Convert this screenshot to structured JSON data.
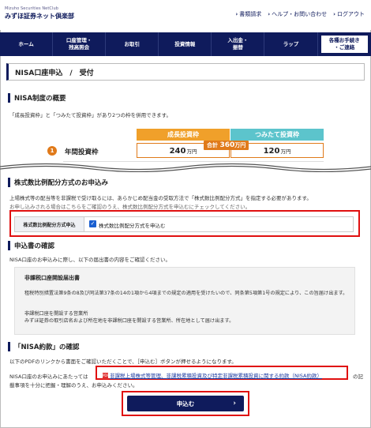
{
  "header": {
    "logo_en": "Mizuho Securities NetClub",
    "logo_jp": "みずほ証券ネット倶楽部",
    "links": [
      "書類請求",
      "ヘルプ・お問い合わせ",
      "ログアウト"
    ]
  },
  "nav": [
    "ホーム",
    "口座管理・\n残高照会",
    "お取引",
    "投資情報",
    "入出金・\n振替",
    "ラップ",
    "各種お手続き\n・ご連絡"
  ],
  "page_title": "NISA口座申込　/　受付",
  "overview": {
    "heading": "NISA制度の概要",
    "text": "「成長投資枠」と「つみたて投資枠」があり2つの枠を併用できます。",
    "growth_label": "成長投資枠",
    "tsumi_label": "つみたて投資枠",
    "badge": "1",
    "annual_label": "年間投資枠",
    "growth_value": "240",
    "tsumi_value": "120",
    "unit": "万円",
    "total_prefix": "合計",
    "total_value": "360",
    "total_unit": "万円"
  },
  "ratio": {
    "heading": "株式数比例配分方式のお申込み",
    "text1": "上場株式等の配当等を非課税で受け取るには、あらかじめ配当金の受取方法で「株式数比例配分方式」を指定する必要があります。",
    "text2": "お申し込みされる場合はこちらをご確認のうえ、株式数比例配分方式を申込むにチェックしてください。",
    "label": "株式数比例配分方式申込",
    "checkbox_text": "株式数比例配分方式を申込む"
  },
  "confirm": {
    "heading": "申込書の確認",
    "text": "NISA口座のお申込みに際し、以下の届出書の内容をご確認ください。",
    "doc_title": "非課税口座開設届出書",
    "doc_p1": "租税特別措置法第9条の8及び同法第37条の14の1項から4項までの規定の適用を受けたいので、同条第5項第1号の規定により、この旨届け出ます。",
    "doc_p2": "非課税口座を開設する営業所",
    "doc_p3": "みずほ証券の取引店名および所在地を非課税口座を開設する営業所、所在地として届け出ます。"
  },
  "yakkan": {
    "heading": "「NISA約款」の確認",
    "text1": "以下のPDFのリンクから書面をご確認いただくことで、［申込む］ボタンが押せるようになります。",
    "text2_pre": "NISA口座のお申込みにあたっては",
    "text2_post": "の記",
    "text3": "載事項を十分に把握・理解のうえ、お申込みください。",
    "pdf_icon": "PDF",
    "pdf_link": "非課税上場株式等管理、非課税累積投資及び特定非課税累積投資に関する約款（NISA約款）"
  },
  "submit_label": "申込む",
  "colors": {
    "navy": "#0f1b5c",
    "growth": "#f0a02a",
    "tsumi": "#5cc4cc",
    "accent": "#e07a1a",
    "highlight": "#e01010"
  }
}
